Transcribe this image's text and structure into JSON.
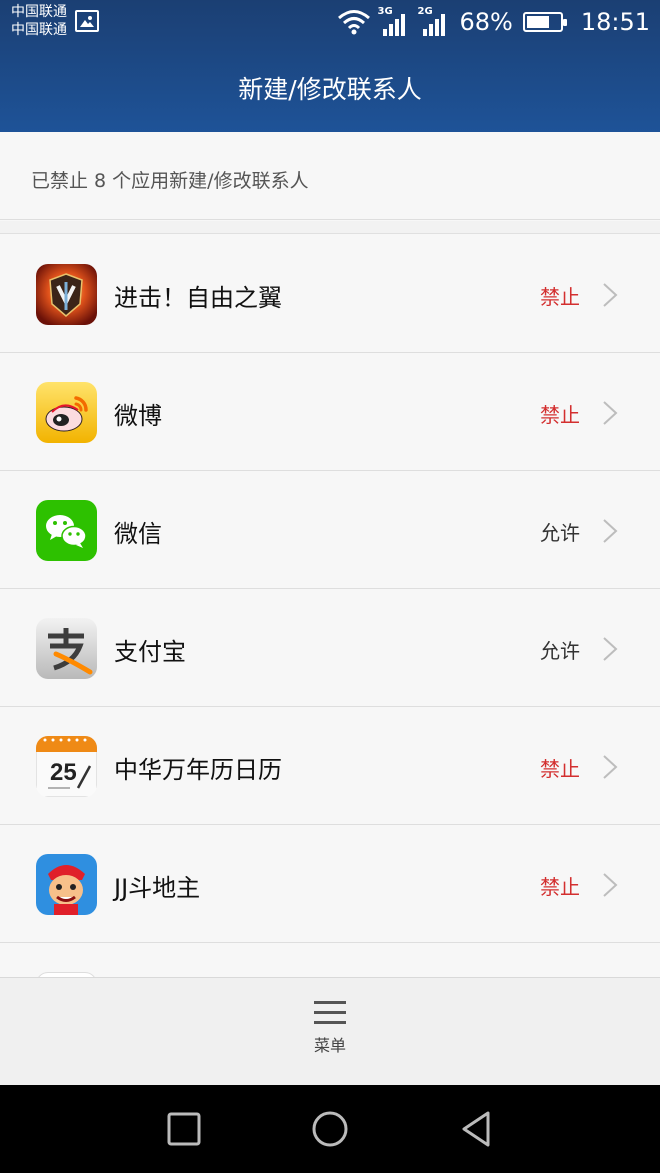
{
  "status_bar": {
    "carrier_1": "中国联通",
    "carrier_2": "中国联通",
    "network_1": "3G",
    "network_2": "2G",
    "battery_percent": "68%",
    "battery_level": 0.68,
    "time": "18:51",
    "icons": [
      "gallery-icon",
      "wifi-icon",
      "signal-icon",
      "battery-icon"
    ]
  },
  "header": {
    "title": "新建/修改联系人"
  },
  "notice": {
    "text": "已禁止 8 个应用新建/修改联系人"
  },
  "apps": [
    {
      "name": "进击！自由之翼",
      "status": "禁止",
      "type": "deny",
      "icon": "attack-on-titan-icon"
    },
    {
      "name": "微博",
      "status": "禁止",
      "type": "deny",
      "icon": "weibo-icon"
    },
    {
      "name": "微信",
      "status": "允许",
      "type": "allow",
      "icon": "wechat-icon"
    },
    {
      "name": "支付宝",
      "status": "允许",
      "type": "allow",
      "icon": "alipay-icon"
    },
    {
      "name": "中华万年历日历",
      "status": "禁止",
      "type": "deny",
      "icon": "calendar-icon",
      "icon_text": "25"
    },
    {
      "name": "JJ斗地主",
      "status": "禁止",
      "type": "deny",
      "icon": "jj-doudizhu-icon"
    }
  ],
  "bottom_bar": {
    "menu_label": "菜单"
  },
  "colors": {
    "header": "#1e5398",
    "deny": "#d32f2f",
    "allow": "#333333",
    "wechat": "#2dc100",
    "alipay_orange": "#ff8a00"
  }
}
